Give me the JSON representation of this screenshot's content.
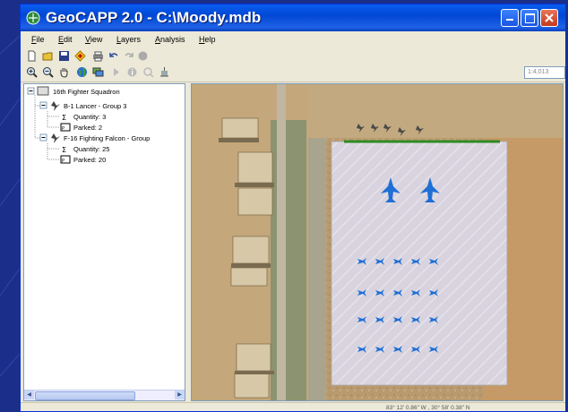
{
  "window": {
    "title": "GeoCAPP 2.0 - C:\\Moody.mdb",
    "controls": [
      "minimize",
      "maximize",
      "close"
    ]
  },
  "menu": {
    "items": [
      "File",
      "Edit",
      "View",
      "Layers",
      "Analysis",
      "Help"
    ]
  },
  "toolbar_standard": {
    "icons": [
      "new-file-icon",
      "open-folder-icon",
      "save-icon",
      "add-layer-icon",
      "print-icon",
      "undo-icon",
      "redo-icon",
      "record-icon"
    ]
  },
  "toolbar_map": {
    "icons": [
      "zoom-in-icon",
      "zoom-out-icon",
      "pan-hand-icon",
      "full-extent-globe-icon",
      "layers-icon",
      "select-arrow-icon",
      "identify-icon",
      "find-icon",
      "measure-icon"
    ],
    "scale": "1:4,013"
  },
  "tree": {
    "root": "16th Fighter Squadron",
    "groups": [
      {
        "label": "B-1 Lancer - Group 3",
        "quantity": "Quantity: 3",
        "parked": "Parked: 2"
      },
      {
        "label": "F-16 Fighting Falcon - Group",
        "quantity": "Quantity: 25",
        "parked": "Parked: 20"
      }
    ]
  },
  "map": {
    "large_aircraft_count": 2,
    "small_aircraft_count": 20,
    "accent_colors": {
      "aircraft": "#1f6fd6",
      "apron_edge": "#2f8a24",
      "apron": "#d6d2dc"
    }
  },
  "status": {
    "coordinates": "83° 12' 0.86\" W , 30° 58' 0.38\" N"
  }
}
